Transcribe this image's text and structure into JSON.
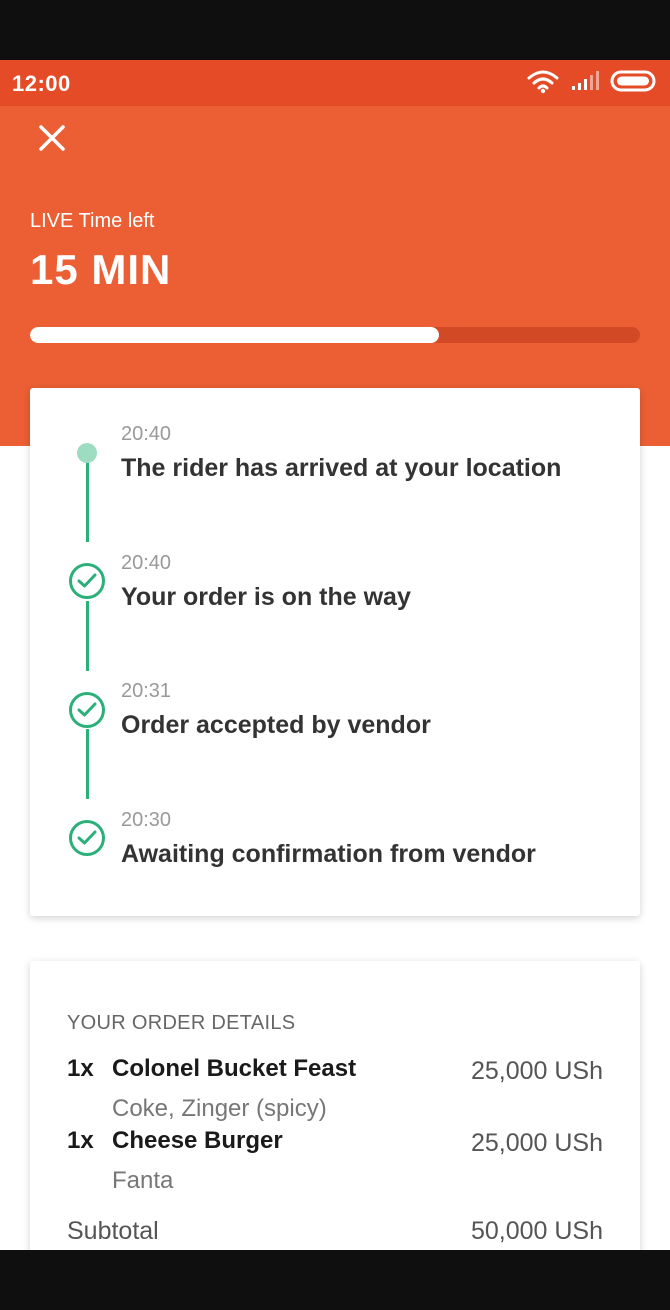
{
  "status_bar": {
    "time": "12:00",
    "icons": [
      "wifi-icon",
      "signal-icon",
      "battery-icon"
    ]
  },
  "header": {
    "close_icon": "close-icon",
    "live_label": "LIVE Time left",
    "time_left": "15 MIN",
    "progress_fraction": 0.67
  },
  "timeline": {
    "events": [
      {
        "time": "20:40",
        "text": "The rider has arrived at your location",
        "state": "current"
      },
      {
        "time": "20:40",
        "text": "Your order is on the way",
        "state": "done"
      },
      {
        "time": "20:31",
        "text": "Order accepted by vendor",
        "state": "done"
      },
      {
        "time": "20:30",
        "text": "Awaiting confirmation from vendor",
        "state": "done"
      }
    ]
  },
  "order_details": {
    "title": "YOUR ORDER DETAILS",
    "items": [
      {
        "qty": "1x",
        "name": "Colonel Bucket Feast",
        "price": "25,000 USh",
        "extras": "Coke, Zinger (spicy)"
      },
      {
        "qty": "1x",
        "name": "Cheese Burger",
        "price": "25,000 USh",
        "extras": "Fanta"
      }
    ],
    "subtotal_label": "Subtotal",
    "subtotal_value": "50,000 USh"
  },
  "colors": {
    "brand_orange": "#ec5f34",
    "status_orange": "#e44b26",
    "timeline_green": "#2bb07a",
    "current_dot": "#9ddcc0"
  }
}
